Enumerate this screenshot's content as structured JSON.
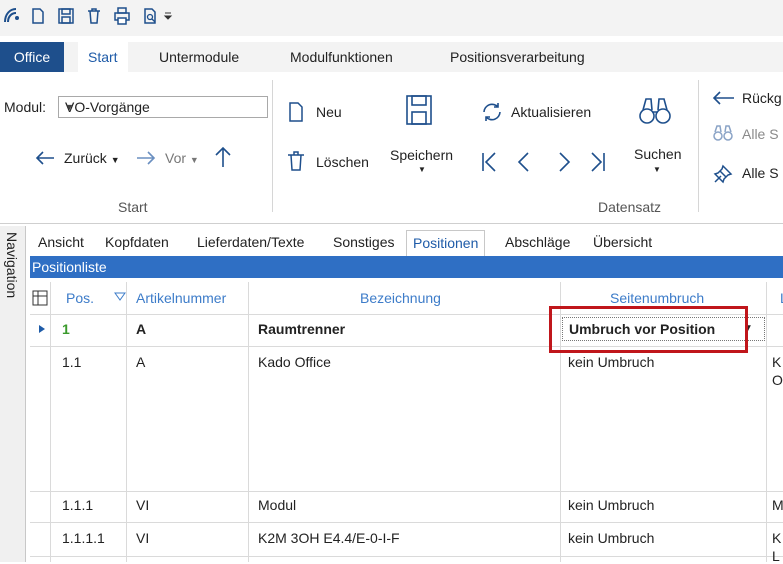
{
  "quick_access": {
    "icons": [
      "app-logo-icon",
      "new-document-icon",
      "save-icon",
      "delete-icon",
      "print-icon",
      "print-preview-icon",
      "customize-arrow-icon"
    ]
  },
  "tabs": [
    "Office",
    "Start",
    "Untermodule",
    "Modulfunktionen",
    "Positionsverarbeitung"
  ],
  "ribbon": {
    "modul_label": "Modul:",
    "modul_value": "VO-Vorgänge",
    "back_label": "Zurück",
    "forward_label": "Vor",
    "new_label": "Neu",
    "delete_label": "Löschen",
    "save_label": "Speichern",
    "refresh_label": "Aktualisieren",
    "search_label": "Suchen",
    "rueck_label": "Rückg",
    "alle_s1_label": "Alle S",
    "alle_s2_label": "Alle S",
    "group_start": "Start",
    "group_datensatz": "Datensatz"
  },
  "navigation_label": "Navigation",
  "subtabs": [
    "Ansicht",
    "Kopfdaten",
    "Lieferdaten/Texte",
    "Sonstiges",
    "Positionen",
    "Abschläge",
    "Übersicht"
  ],
  "positionliste_title": "Positionliste",
  "grid": {
    "headers": {
      "pos": "Pos.",
      "artikelnummer": "Artikelnummer",
      "bezeichnung": "Bezeichnung",
      "seitenumbruch": "Seitenumbruch",
      "extra": "L"
    },
    "rows": [
      {
        "pos": "1",
        "art": "A",
        "bez": "Raumtrenner",
        "umbruch": "Umbruch vor Position",
        "extra": ""
      },
      {
        "pos": "1.1",
        "art": "A",
        "bez": "Kado Office",
        "umbruch": "kein Umbruch",
        "extra": "K",
        "extra2": "O"
      },
      {
        "pos": "1.1.1",
        "art": "VI",
        "bez": "Modul",
        "umbruch": "kein Umbruch",
        "extra": "M"
      },
      {
        "pos": "1.1.1.1",
        "art": "VI",
        "bez": "K2M 3OH E4.4/E-0-I-F",
        "umbruch": "kein Umbruch",
        "extra": "K",
        "extra2": "L"
      }
    ]
  }
}
